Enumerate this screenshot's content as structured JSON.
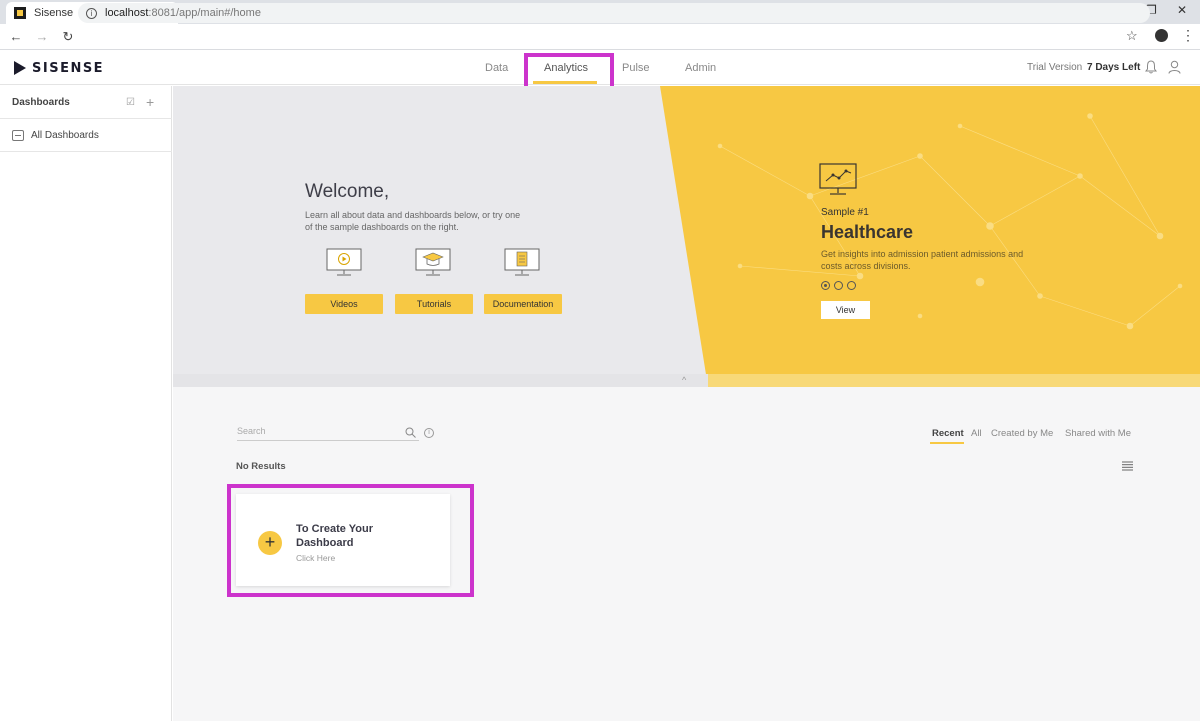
{
  "browser": {
    "tab_title": "Sisense",
    "new_tab": "+",
    "url_host": "localhost",
    "url_path": ":8081/app/main#/home"
  },
  "app": {
    "logo_text": "SISENSE",
    "nav": [
      "Data",
      "Analytics",
      "Pulse",
      "Admin"
    ],
    "active_nav": "Analytics",
    "trial_label": "Trial Version",
    "days_left": "7 Days Left"
  },
  "sidebar": {
    "title": "Dashboards",
    "items": [
      {
        "label": "All Dashboards"
      }
    ]
  },
  "hero": {
    "welcome_title": "Welcome,",
    "welcome_sub": "Learn all about data and dashboards below, or try one of the sample dashboards on the right.",
    "buttons": [
      "Videos",
      "Tutorials",
      "Documentation"
    ],
    "sample_num": "Sample #1",
    "sample_title": "Healthcare",
    "sample_desc": "Get insights into admission patient admissions and costs across divisions.",
    "view_label": "View"
  },
  "main": {
    "search_placeholder": "Search",
    "filters": [
      "Recent",
      "All",
      "Created by Me",
      "Shared with Me"
    ],
    "active_filter": "Recent",
    "no_results": "No Results",
    "card_title": "To Create Your Dashboard",
    "card_sub": "Click Here"
  },
  "colors": {
    "accent": "#f7c843",
    "highlight": "#cc33cc",
    "hero_grey": "#e9e9ec"
  }
}
